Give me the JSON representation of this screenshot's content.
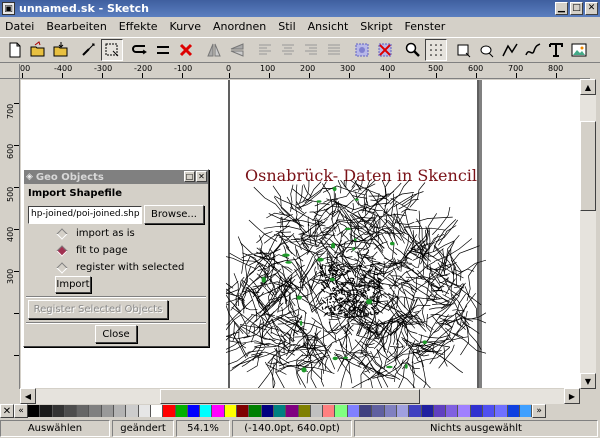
{
  "window": {
    "title": "unnamed.sk - Sketch"
  },
  "menu": [
    "Datei",
    "Bearbeiten",
    "Effekte",
    "Kurve",
    "Anordnen",
    "Stil",
    "Ansicht",
    "Skript",
    "Fenster"
  ],
  "toolbar": {
    "icons": [
      "new-file-icon",
      "open-file-icon",
      "save-file-icon",
      "sep",
      "select-node-icon",
      "select-edit-icon",
      "sep",
      "bezier-icon",
      "align-icon",
      "delete-icon",
      "sep",
      "flip-h-icon",
      "flip-v-icon",
      "sep",
      "text-left-icon",
      "text-center-icon",
      "text-right-icon",
      "text-justify-icon",
      "sep",
      "group-icon",
      "ungroup-icon",
      "sep",
      "zoom-icon",
      "grid-icon",
      "sep",
      "rectangle-icon",
      "ellipse-icon",
      "polyline-icon",
      "freehand-icon",
      "text-tool-icon",
      "image-tool-icon"
    ]
  },
  "hruler": {
    "labels": [
      "00",
      "-400",
      "-300",
      "-200",
      "-100",
      "0",
      "100",
      "200",
      "300",
      "400",
      "500",
      "600",
      "700",
      "800"
    ]
  },
  "vruler": {
    "labels": [
      "700",
      "600",
      "500",
      "400",
      "300"
    ]
  },
  "canvas": {
    "title": "Osnabrück- Daten in Skencil"
  },
  "dialog": {
    "title": "Geo Objects",
    "section": "Import Shapefile",
    "file_value": "hp-joined/poi-joined.shp",
    "browse_label": "Browse...",
    "options": [
      {
        "label": "import as is",
        "selected": false
      },
      {
        "label": "fit to page",
        "selected": true
      },
      {
        "label": "register with selected",
        "selected": false
      }
    ],
    "import_label": "Import",
    "register_label": "Register Selected Objects",
    "close_label": "Close"
  },
  "palette": {
    "colors": [
      "#000000",
      "#1a1a1a",
      "#333333",
      "#4d4d4d",
      "#666666",
      "#808080",
      "#999999",
      "#b3b3b3",
      "#cccccc",
      "#e6e6e6",
      "#ffffff",
      "#ff0000",
      "#00b000",
      "#0000ff",
      "#00ffff",
      "#ff00ff",
      "#ffff00",
      "#800000",
      "#008000",
      "#000080",
      "#008080",
      "#800080",
      "#808000",
      "#c0c0c0",
      "#ff8080",
      "#80ff80",
      "#8080ff",
      "#404080",
      "#6060a0",
      "#8080c0",
      "#a0a0e0",
      "#4040c0",
      "#2020a0",
      "#6040c0",
      "#8060e0",
      "#a080ff",
      "#3030d0",
      "#5050f0",
      "#7070ff",
      "#1040e0",
      "#40a0ff"
    ]
  },
  "status": {
    "mode": "Auswählen",
    "modified": "geändert",
    "zoom": "54.1%",
    "coords": "(-140.0pt, 640.0pt)",
    "selection": "Nichts ausgewählt"
  }
}
